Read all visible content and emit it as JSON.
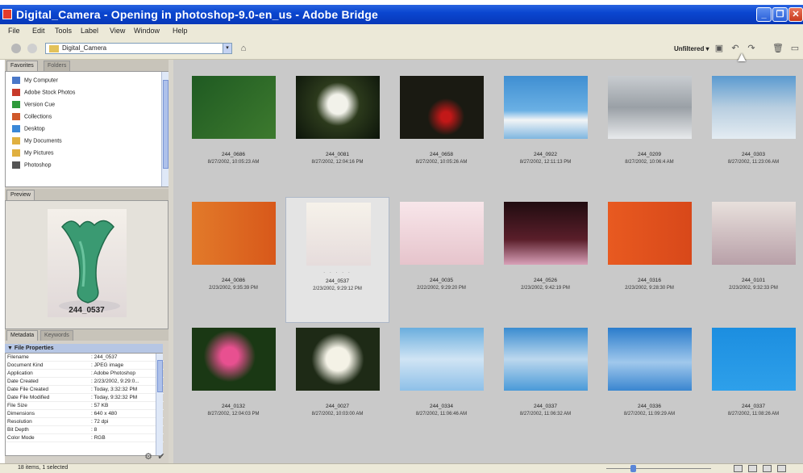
{
  "window": {
    "title": "Digital_Camera - Opening in photoshop-9.0-en_us - Adobe Bridge",
    "min_symbol": "_",
    "max_symbol": "❐",
    "close_symbol": "✕"
  },
  "menu": [
    "File",
    "Edit",
    "Tools",
    "Label",
    "View",
    "Window",
    "Help"
  ],
  "toolbar": {
    "path": "Digital_Camera",
    "filter_label": "Unfiltered ▾"
  },
  "favorites": {
    "tabs": [
      "Favorites",
      "Folders"
    ],
    "items": [
      {
        "label": "My Computer",
        "color": "#4a78c8"
      },
      {
        "label": "Adobe Stock Photos",
        "color": "#c83a2a"
      },
      {
        "label": "Version Cue",
        "color": "#2e9a3a"
      },
      {
        "label": "Collections",
        "color": "#d0582a"
      },
      {
        "label": "Desktop",
        "color": "#3a88d8"
      },
      {
        "label": "My Documents",
        "color": "#e0b040"
      },
      {
        "label": "My Pictures",
        "color": "#e0b040"
      },
      {
        "label": "Photoshop",
        "color": "#555555"
      }
    ]
  },
  "preview": {
    "tab": "Preview",
    "caption": "244_0537"
  },
  "metadata": {
    "tabs": [
      "Metadata",
      "Keywords"
    ],
    "section": "▼ File Properties",
    "rows": [
      {
        "key": "Filename",
        "value": ": 244_0537"
      },
      {
        "key": "Document Kind",
        "value": ": JPEG image"
      },
      {
        "key": "Application",
        "value": ": Adobe Photoshop"
      },
      {
        "key": "Date Created",
        "value": ": 2/23/2002, 9:29:0..."
      },
      {
        "key": "Date File Created",
        "value": ": Today, 3:32:32 PM"
      },
      {
        "key": "Date File Modified",
        "value": ": Today, 9:32:32 PM"
      },
      {
        "key": "File Size",
        "value": ": 57 KB"
      },
      {
        "key": "Dimensions",
        "value": ": 640 x 480"
      },
      {
        "key": "Resolution",
        "value": ": 72 dpi"
      },
      {
        "key": "Bit Depth",
        "value": ": 8"
      },
      {
        "key": "Color Mode",
        "value": ": RGB"
      }
    ]
  },
  "thumbnails": [
    {
      "name": "244_0686",
      "date": "8/27/2002, 10:05:23 AM",
      "kind": "redflowers"
    },
    {
      "name": "244_0081",
      "date": "8/27/2002, 12:04:16 PM",
      "kind": "whiteflowers"
    },
    {
      "name": "244_0658",
      "date": "8/27/2002, 10:05:26 AM",
      "kind": "darkred"
    },
    {
      "name": "244_0922",
      "date": "8/27/2002, 12:11:13 PM",
      "kind": "sky1"
    },
    {
      "name": "244_0209",
      "date": "8/27/2002, 10:06:4 AM",
      "kind": "clouds"
    },
    {
      "name": "244_0303",
      "date": "8/27/2002, 11:23:06 AM",
      "kind": "sky2"
    },
    {
      "name": "244_0086",
      "date": "2/23/2002, 9:35:39 PM",
      "kind": "orangeglass"
    },
    {
      "name": "244_0537",
      "date": "2/23/2002, 9:29:12 PM",
      "kind": "vase",
      "selected": true
    },
    {
      "name": "244_0035",
      "date": "2/22/2002, 9:29:20 PM",
      "kind": "pinkglass"
    },
    {
      "name": "244_0526",
      "date": "2/23/2002, 9:42:19 PM",
      "kind": "darkglass"
    },
    {
      "name": "244_0316",
      "date": "2/23/2002, 9:28:30 PM",
      "kind": "redglass"
    },
    {
      "name": "244_0101",
      "date": "2/23/2002, 9:32:33 PM",
      "kind": "swirl"
    },
    {
      "name": "244_0132",
      "date": "8/27/2002, 12:04:03 PM",
      "kind": "pinkflowers"
    },
    {
      "name": "244_0027",
      "date": "8/27/2002, 10:03:00 AM",
      "kind": "whiteflowers2"
    },
    {
      "name": "244_0334",
      "date": "8/27/2002, 11:06:46 AM",
      "kind": "sky3"
    },
    {
      "name": "244_0337",
      "date": "8/27/2002, 11:06:32 AM",
      "kind": "sky4"
    },
    {
      "name": "244_0336",
      "date": "8/27/2002, 11:09:29 AM",
      "kind": "sky5"
    },
    {
      "name": "244_0337",
      "date": "8/27/2002, 11:08:26 AM",
      "kind": "bluesky"
    }
  ],
  "status": {
    "text": "18 items, 1 selected"
  }
}
